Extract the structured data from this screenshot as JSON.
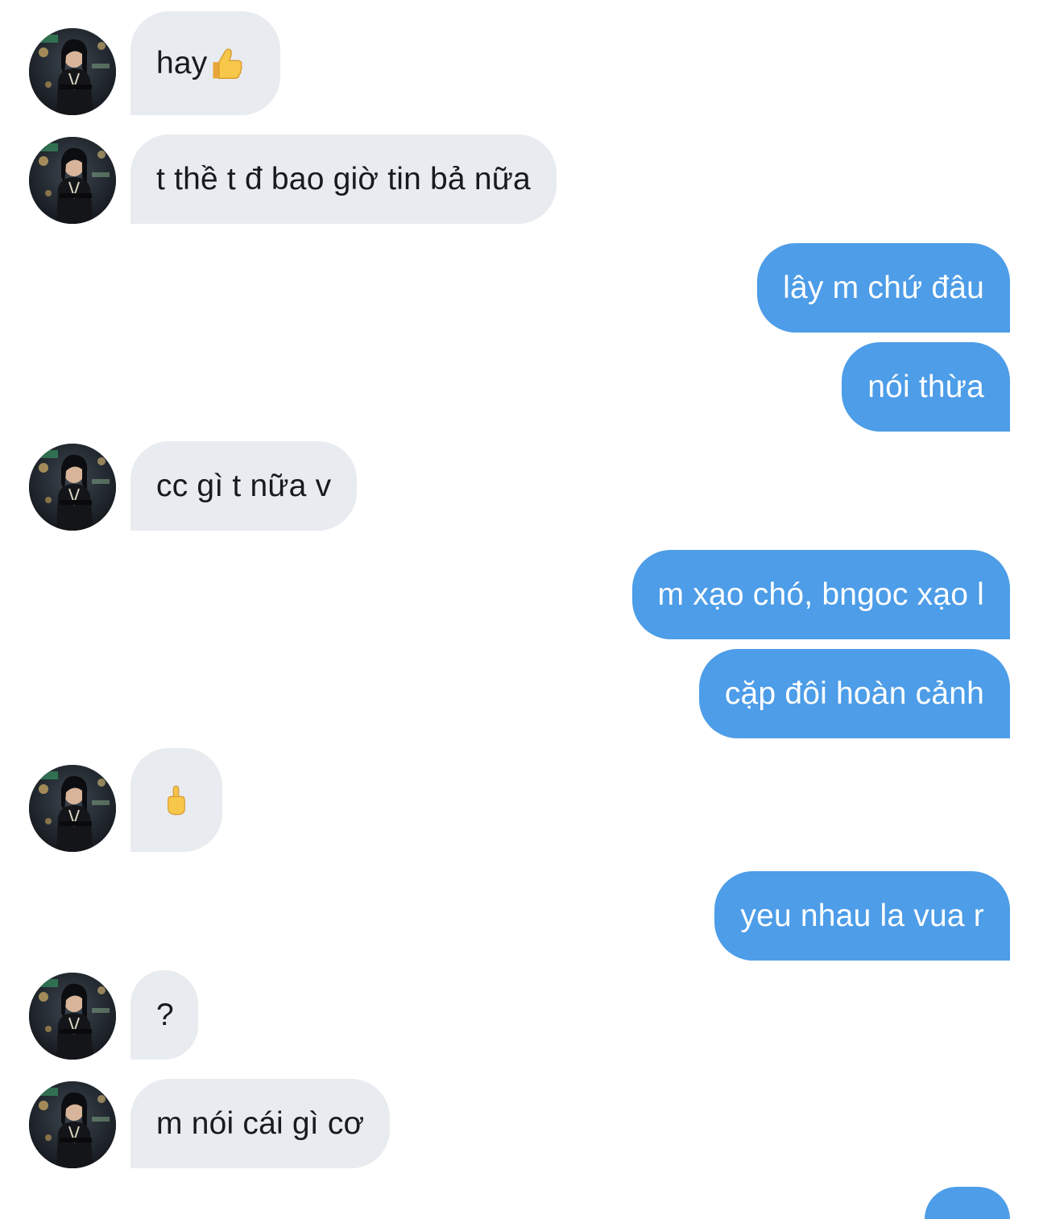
{
  "colors": {
    "incoming_bubble": "#e8ebef",
    "outgoing_bubble": "#4d9de8",
    "incoming_text": "#171a1f",
    "outgoing_text": "#ffffff"
  },
  "messages": [
    {
      "direction": "in",
      "text": "hay",
      "emoji": "thumbs-up"
    },
    {
      "direction": "in",
      "text": "t thề t đ bao giờ tin bả nữa"
    },
    {
      "direction": "out",
      "text": "lây m chứ đâu"
    },
    {
      "direction": "out",
      "text": "nói thừa"
    },
    {
      "direction": "in",
      "text": "cc gì t nữa v"
    },
    {
      "direction": "out",
      "text": "m xạo chó, bngoc xạo l"
    },
    {
      "direction": "out",
      "text": "cặp đôi hoàn cảnh"
    },
    {
      "direction": "in",
      "text": "",
      "emoji": "middle-finger"
    },
    {
      "direction": "out",
      "text": "yeu nhau la vua r"
    },
    {
      "direction": "in",
      "text": "?"
    },
    {
      "direction": "in",
      "text": "m nói cái gì cơ"
    }
  ]
}
